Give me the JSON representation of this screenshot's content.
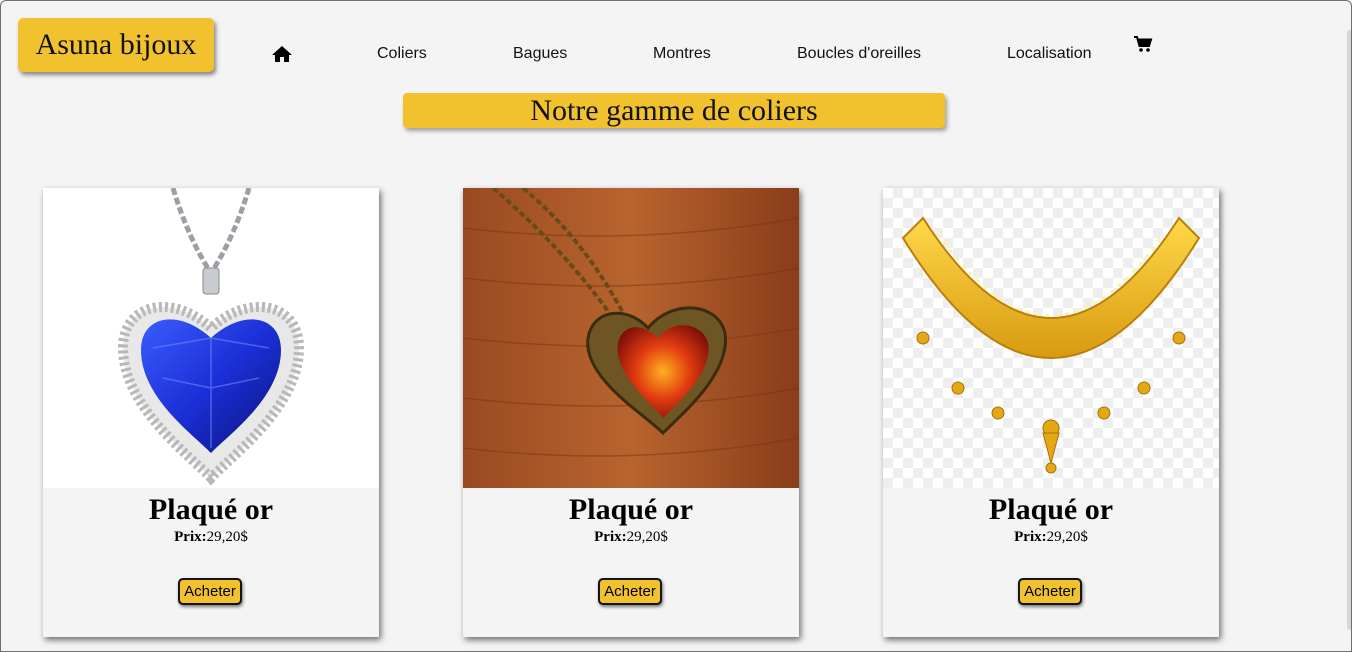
{
  "brand": {
    "name": "Asuna bijoux"
  },
  "nav": {
    "home_icon": "home-icon",
    "items": [
      {
        "label": "Coliers"
      },
      {
        "label": "Bagues"
      },
      {
        "label": "Montres"
      },
      {
        "label": "Boucles d'oreilles"
      },
      {
        "label": "Localisation"
      }
    ],
    "cart_icon": "cart-icon"
  },
  "section": {
    "title": "Notre gamme de coliers"
  },
  "products": [
    {
      "title": "Plaqué or",
      "price_label": "Prix:",
      "price": "29,20$",
      "button": "Acheter",
      "image": "blue-heart-necklace"
    },
    {
      "title": "Plaqué or",
      "price_label": "Prix:",
      "price": "29,20$",
      "button": "Acheter",
      "image": "bronze-heart-locket"
    },
    {
      "title": "Plaqué or",
      "price_label": "Prix:",
      "price": "29,20$",
      "button": "Acheter",
      "image": "gold-necklace"
    }
  ],
  "colors": {
    "accent": "#f2c12e",
    "background": "#f4f4f4"
  }
}
